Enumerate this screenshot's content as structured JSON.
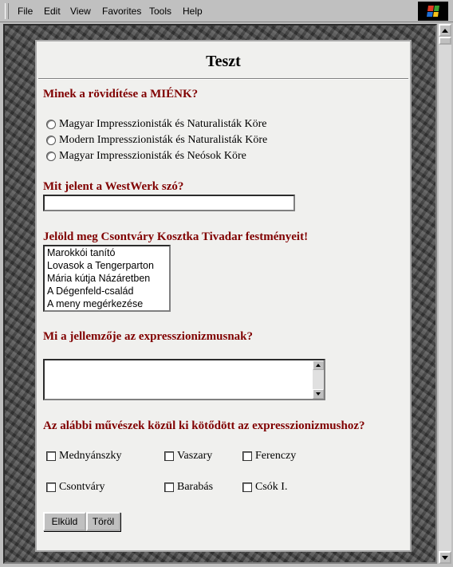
{
  "menu": {
    "items": [
      "File",
      "Edit",
      "View",
      "Favorites",
      "Tools",
      "Help"
    ]
  },
  "form": {
    "title": "Teszt",
    "q1": {
      "label": "Minek a rövidítése a MIÉNK?",
      "options": [
        "Magyar Impresszionisták és Naturalisták Köre",
        "Modern Impresszionisták és Naturalisták Köre",
        "Magyar Impresszionisták és Neósok Köre"
      ]
    },
    "q2": {
      "label": "Mit jelent a WestWerk szó?",
      "value": ""
    },
    "q3": {
      "label": "Jelöld meg Csontváry Kosztka Tivadar festményeit!",
      "options": [
        "Marokkói tanító",
        "Lovasok a Tengerparton",
        "Mária kútja Názáretben",
        "A Dégenfeld-család",
        "A meny megérkezése"
      ]
    },
    "q4": {
      "label": "Mi a jellemzője az expresszionizmusnak?",
      "value": ""
    },
    "q5": {
      "label": "Az alábbi művészek közül ki kötődött az expresszionizmushoz?",
      "options": [
        "Mednyánszky",
        "Vaszary",
        "Ferenczy",
        "Csontváry",
        "Barabás",
        "Csók I."
      ]
    },
    "submit_label": "Elküld",
    "reset_label": "Töröl"
  }
}
